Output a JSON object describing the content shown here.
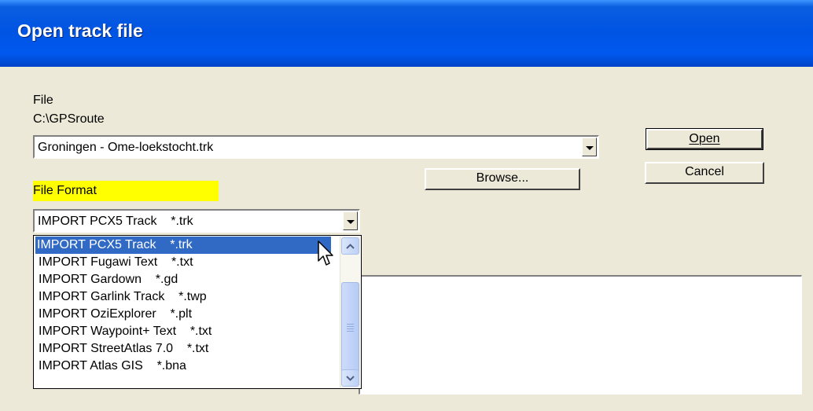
{
  "window": {
    "title": "Open track file"
  },
  "file": {
    "label": "File",
    "path": "C:\\GPSroute",
    "selected": "Groningen - Ome-loekstocht.trk"
  },
  "buttons": {
    "open": "Open",
    "cancel": "Cancel",
    "browse": "Browse..."
  },
  "format": {
    "label": "File Format",
    "selected": "IMPORT PCX5 Track    *.trk",
    "options": [
      "IMPORT PCX5 Track    *.trk",
      "IMPORT Fugawi Text    *.txt",
      "IMPORT Gardown    *.gd",
      "IMPORT Garlink Track    *.twp",
      "IMPORT OziExplorer    *.plt",
      "IMPORT Waypoint+ Text    *.txt",
      "IMPORT StreetAtlas 7.0    *.txt",
      "IMPORT Atlas GIS    *.bna"
    ]
  },
  "icons": {
    "combo_arrow": "chevron-down-icon",
    "scroll_up": "chevron-up-icon",
    "scroll_down": "chevron-down-icon",
    "cursor": "arrow-cursor-icon"
  },
  "colors": {
    "titlebar": "#0054e3",
    "highlight_label": "#ffff00",
    "selection": "#316ac5",
    "dialog_bg": "#ece9d8"
  }
}
